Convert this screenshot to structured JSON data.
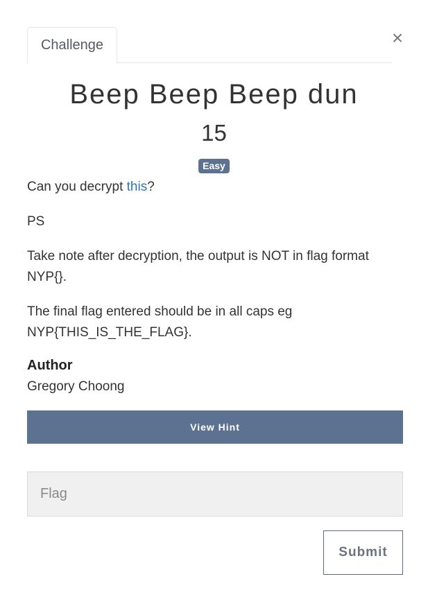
{
  "tabs": [
    {
      "label": "Challenge"
    }
  ],
  "close_label": "×",
  "challenge": {
    "title": "Beep Beep Beep dun",
    "points": "15",
    "difficulty": "Easy",
    "description": {
      "line1_prefix": "Can you decrypt ",
      "line1_link": "this",
      "line1_suffix": "?",
      "line2": "PS",
      "line3": "Take note after decryption, the output is NOT in flag format NYP{}.",
      "line4": "The final flag entered should be in all caps eg NYP{THIS_IS_THE_FLAG}."
    },
    "author_heading": "Author",
    "author_name": "Gregory Choong"
  },
  "hint_button_label": "View Hint",
  "flag_input": {
    "placeholder": "Flag",
    "value": ""
  },
  "submit_label": "Submit",
  "colors": {
    "accent": "#5c7290",
    "link": "#2e77b5"
  }
}
